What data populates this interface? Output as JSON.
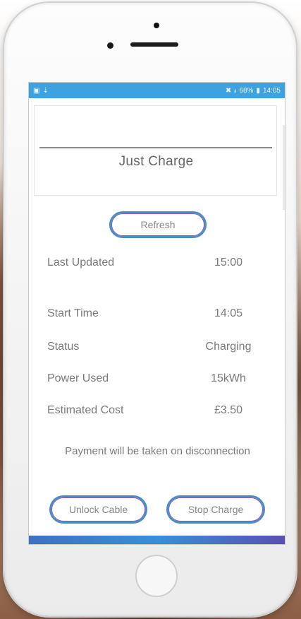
{
  "status_bar": {
    "left_icons": [
      "image-icon",
      "download-icon"
    ],
    "mute_glyph": "✖",
    "signal_glyph": "ᵢₗ",
    "battery_text": "68%",
    "time": "14:05"
  },
  "card": {
    "title": "Just Charge"
  },
  "buttons": {
    "refresh": "Refresh",
    "unlock": "Unlock Cable",
    "stop": "Stop Charge"
  },
  "details": {
    "last_updated": {
      "label": "Last Updated",
      "value": "15:00"
    },
    "start_time": {
      "label": "Start Time",
      "value": "14:05"
    },
    "status": {
      "label": "Status",
      "value": "Charging"
    },
    "power_used": {
      "label": "Power Used",
      "value": "15kWh"
    },
    "estimated_cost": {
      "label": "Estimated Cost",
      "value": "£3.50"
    }
  },
  "notice": "Payment will be taken on disconnection",
  "colors": {
    "status_bar": "#3ea2e0",
    "button_border": "#4a8cc6",
    "button_accent": "#8a58b6",
    "text": "#7a7a7a"
  }
}
